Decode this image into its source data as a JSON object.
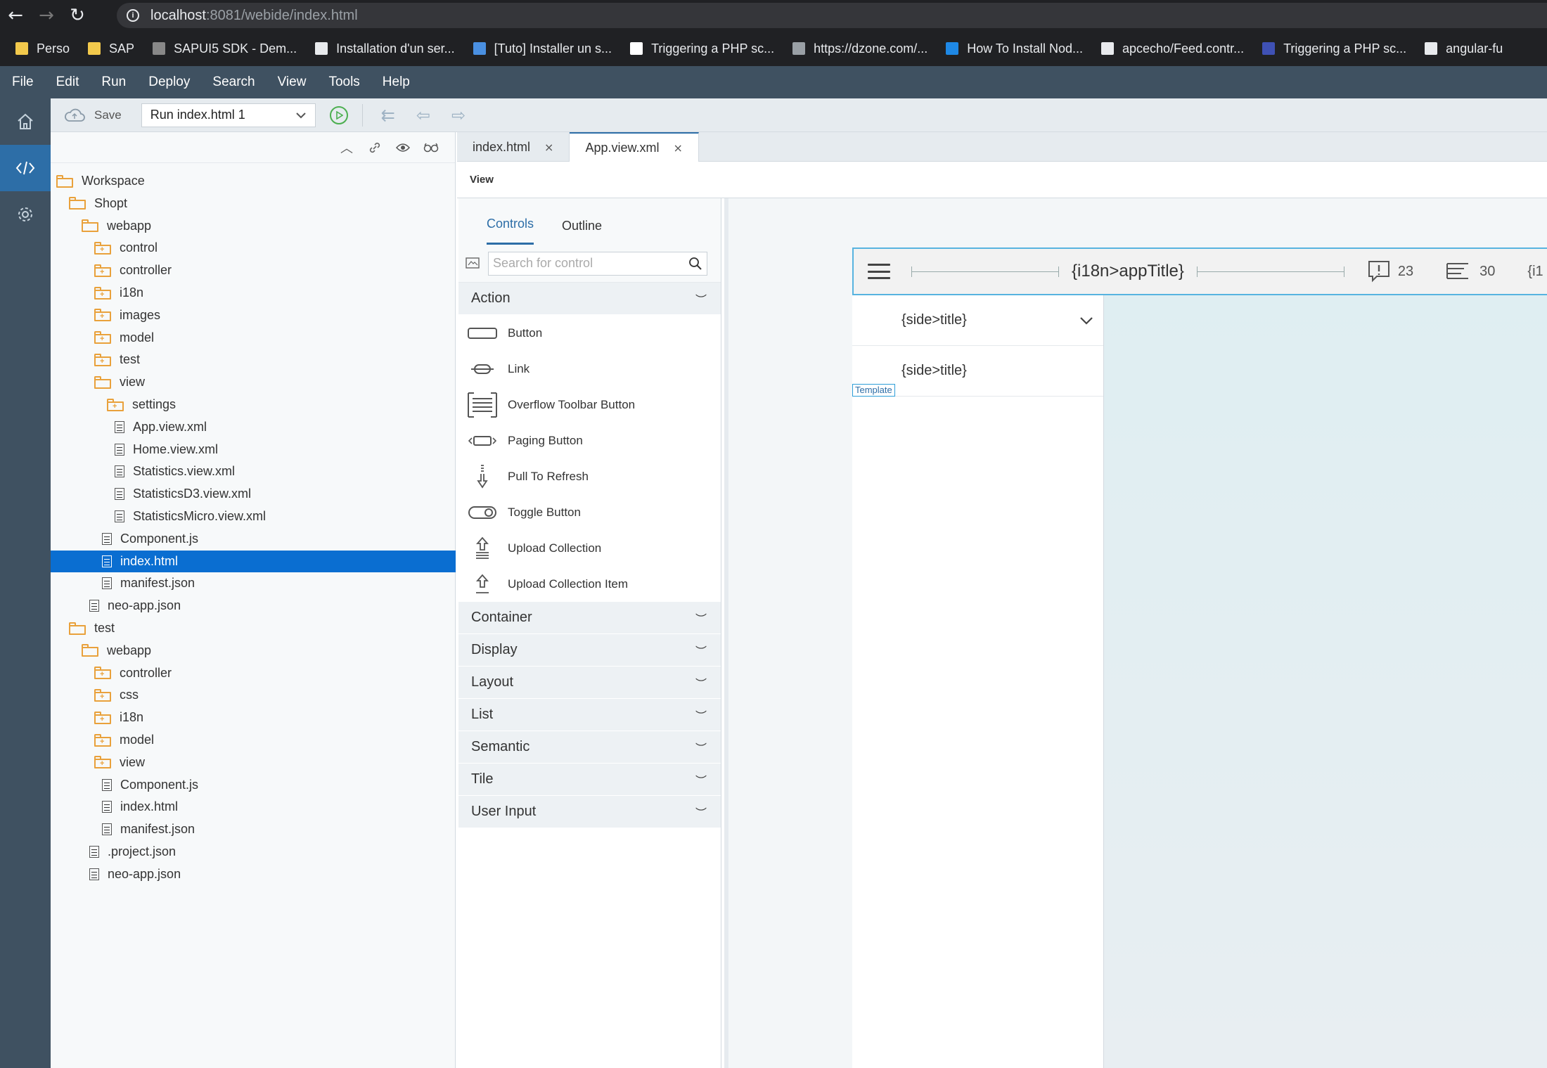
{
  "browser": {
    "url_host": "localhost",
    "url_rest": ":8081/webide/index.html",
    "bookmarks": [
      {
        "label": "Perso",
        "color": "#f2c94c"
      },
      {
        "label": "SAP",
        "color": "#f2c94c"
      },
      {
        "label": "SAPUI5 SDK - Dem...",
        "color": "#888888"
      },
      {
        "label": "Installation d'un ser...",
        "color": "#e8eaed"
      },
      {
        "label": "[Tuto] Installer un s...",
        "color": "#4a90e2"
      },
      {
        "label": "Triggering a PHP sc...",
        "color": "#ffffff"
      },
      {
        "label": "https://dzone.com/...",
        "color": "#9aa0a6"
      },
      {
        "label": "How To Install Nod...",
        "color": "#1e88e5"
      },
      {
        "label": "apcecho/Feed.contr...",
        "color": "#e8eaed"
      },
      {
        "label": "Triggering a PHP sc...",
        "color": "#3f51b5"
      },
      {
        "label": "angular-fu",
        "color": "#e8eaed"
      }
    ]
  },
  "menu": [
    "File",
    "Edit",
    "Run",
    "Deploy",
    "Search",
    "View",
    "Tools",
    "Help"
  ],
  "toolbar": {
    "save_label": "Save",
    "run_config": "Run index.html 1"
  },
  "tree": [
    {
      "label": "Workspace",
      "type": "folder-open",
      "level": 0
    },
    {
      "label": "Shopt",
      "type": "folder-open",
      "level": 1
    },
    {
      "label": "webapp",
      "type": "folder-open",
      "level": 2
    },
    {
      "label": "control",
      "type": "folder",
      "level": 3
    },
    {
      "label": "controller",
      "type": "folder",
      "level": 3
    },
    {
      "label": "i18n",
      "type": "folder",
      "level": 3
    },
    {
      "label": "images",
      "type": "folder",
      "level": 3
    },
    {
      "label": "model",
      "type": "folder",
      "level": 3
    },
    {
      "label": "test",
      "type": "folder",
      "level": 3
    },
    {
      "label": "view",
      "type": "folder-open",
      "level": 3
    },
    {
      "label": "settings",
      "type": "folder",
      "level": 4
    },
    {
      "label": "App.view.xml",
      "type": "file",
      "level": 4
    },
    {
      "label": "Home.view.xml",
      "type": "file",
      "level": 4
    },
    {
      "label": "Statistics.view.xml",
      "type": "file",
      "level": 4
    },
    {
      "label": "StatisticsD3.view.xml",
      "type": "file",
      "level": 4
    },
    {
      "label": "StatisticsMicro.view.xml",
      "type": "file",
      "level": 4
    },
    {
      "label": "Component.js",
      "type": "file",
      "level": 3
    },
    {
      "label": "index.html",
      "type": "file",
      "level": 3,
      "selected": true
    },
    {
      "label": "manifest.json",
      "type": "file",
      "level": 3
    },
    {
      "label": "neo-app.json",
      "type": "file",
      "level": 2
    },
    {
      "label": "test",
      "type": "folder-open",
      "level": 1
    },
    {
      "label": "webapp",
      "type": "folder-open",
      "level": 2
    },
    {
      "label": "controller",
      "type": "folder",
      "level": 3
    },
    {
      "label": "css",
      "type": "folder",
      "level": 3
    },
    {
      "label": "i18n",
      "type": "folder",
      "level": 3
    },
    {
      "label": "model",
      "type": "folder",
      "level": 3
    },
    {
      "label": "view",
      "type": "folder",
      "level": 3
    },
    {
      "label": "Component.js",
      "type": "file",
      "level": 3
    },
    {
      "label": "index.html",
      "type": "file",
      "level": 3
    },
    {
      "label": "manifest.json",
      "type": "file",
      "level": 3
    },
    {
      "label": ".project.json",
      "type": "file",
      "level": 2
    },
    {
      "label": "neo-app.json",
      "type": "file",
      "level": 2
    }
  ],
  "editor_tabs": [
    {
      "label": "index.html",
      "active": false
    },
    {
      "label": "App.view.xml",
      "active": true
    }
  ],
  "view_bar_label": "View",
  "palette": {
    "tabs": [
      "Controls",
      "Outline"
    ],
    "search_placeholder": "Search for control",
    "action_label": "Action",
    "controls": [
      {
        "label": "Button",
        "icon": "button-icon"
      },
      {
        "label": "Link",
        "icon": "link-icon"
      },
      {
        "label": "Overflow Toolbar Button",
        "icon": "overflow-toolbar-icon"
      },
      {
        "label": "Paging Button",
        "icon": "paging-button-icon"
      },
      {
        "label": "Pull To Refresh",
        "icon": "pull-to-refresh-icon"
      },
      {
        "label": "Toggle Button",
        "icon": "toggle-icon"
      },
      {
        "label": "Upload Collection",
        "icon": "upload-collection-icon"
      },
      {
        "label": "Upload Collection Item",
        "icon": "upload-item-icon"
      }
    ],
    "categories": [
      "Container",
      "Display",
      "Layout",
      "List",
      "Semantic",
      "Tile",
      "User Input"
    ]
  },
  "canvas": {
    "app_title": "{i18n>appTitle}",
    "notifications_count": "23",
    "messages_count": "30",
    "overflow_text": "{i1",
    "side_items": [
      "{side>title}",
      "{side>title}"
    ],
    "template_label": "Template"
  },
  "colors": {
    "accent": "#2d6ea7",
    "selection": "#0a6ed1",
    "shell": "#3f5161",
    "folder": "#e9a13b"
  }
}
